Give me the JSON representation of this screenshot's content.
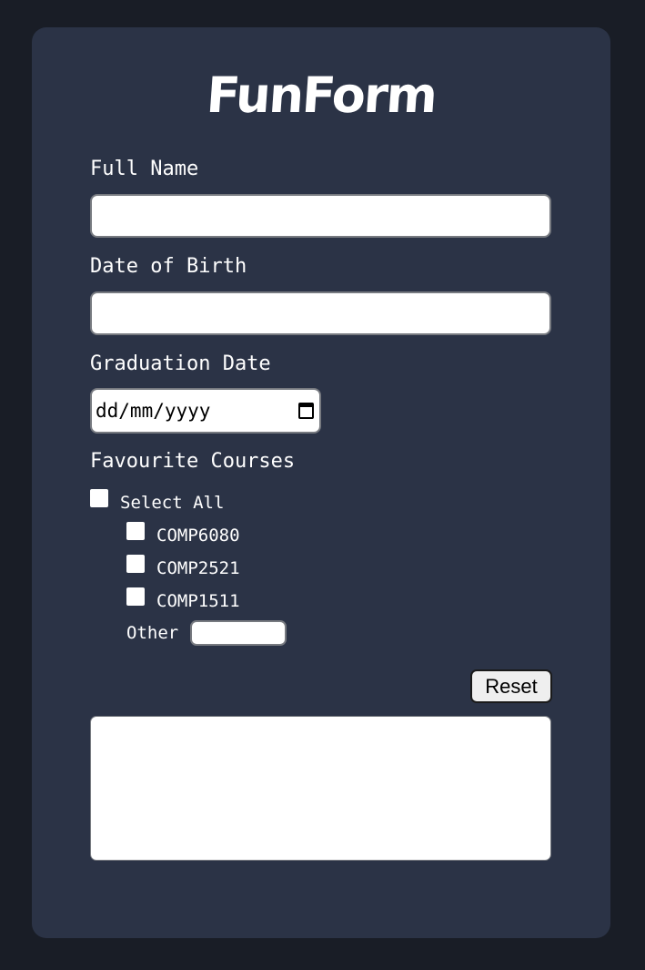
{
  "form": {
    "title": "FunForm",
    "full_name": {
      "label": "Full Name",
      "value": ""
    },
    "date_of_birth": {
      "label": "Date of Birth",
      "value": ""
    },
    "graduation_date": {
      "label": "Graduation Date",
      "placeholder": "dd/mm/yyyy",
      "icon": "calendar-icon"
    },
    "favourite_courses": {
      "label": "Favourite Courses",
      "select_all": {
        "label": "Select All",
        "checked": false
      },
      "courses": [
        {
          "label": "COMP6080",
          "checked": false
        },
        {
          "label": "COMP2521",
          "checked": false
        },
        {
          "label": "COMP1511",
          "checked": false
        }
      ],
      "other": {
        "label": "Other",
        "value": ""
      }
    },
    "reset_label": "Reset",
    "output": {
      "value": ""
    }
  },
  "colors": {
    "page_background": "#191d26",
    "card_background": "#2b3346",
    "text": "#ffffff",
    "input_border": "#777a80"
  }
}
